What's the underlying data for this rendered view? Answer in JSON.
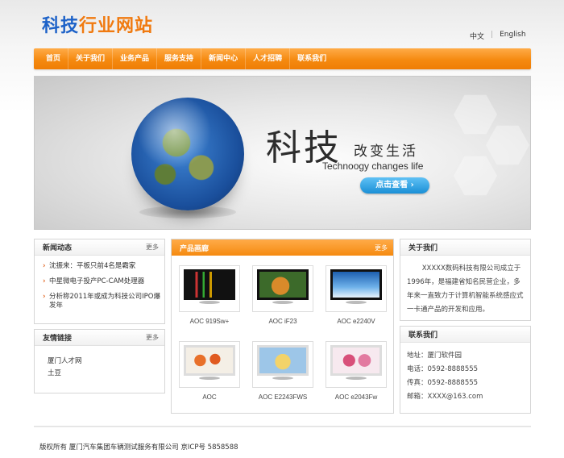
{
  "logo": {
    "part1": "科技",
    "part2": "行业网站"
  },
  "lang": {
    "zh": "中文",
    "en": "English"
  },
  "nav": [
    "首页",
    "关于我们",
    "业务产品",
    "服务支持",
    "新闻中心",
    "人才招聘",
    "联系我们"
  ],
  "banner": {
    "big": "科技",
    "small": "改变生活",
    "english": "Technoogy changes life",
    "button": "点击查看 ›"
  },
  "news": {
    "title": "新闻动态",
    "more": "更多",
    "items": [
      "沈振来：平板只前4名是霸家",
      "中星微电子投产PC-CAM处理器",
      "分析称2011年或成为科技公司IPO爆发年"
    ]
  },
  "links": {
    "title": "友情链接",
    "more": "更多",
    "items": [
      "厦门人才网",
      "土豆"
    ]
  },
  "products": {
    "title": "产品画廊",
    "more": "更多",
    "items": [
      "AOC 919Sw+",
      "AOC iF23",
      "AOC e2240V",
      "AOC",
      "AOC E2243FWS",
      "AOC e2043Fw"
    ]
  },
  "about": {
    "title": "关于我们",
    "text": "XXXXX数码科技有限公司成立于1996年，是福建省知名民营企业，多年来一直致力于计算机智能系统感应式一卡通产品的开发和应用。"
  },
  "contact": {
    "title": "联系我们",
    "lines": [
      "地址：厦门软件园",
      "电话：0592-8888555",
      "传真：0592-8888555",
      "邮箱：XXXX@163.com"
    ]
  },
  "footer": "版权所有 厦门汽车集团车辆测试服务有限公司   京ICP号 5858588",
  "colors": {
    "accent": "#f58a10",
    "logo_blue": "#1d62c8",
    "logo_orange": "#f07a10",
    "button_blue": "#1a8fd6"
  }
}
